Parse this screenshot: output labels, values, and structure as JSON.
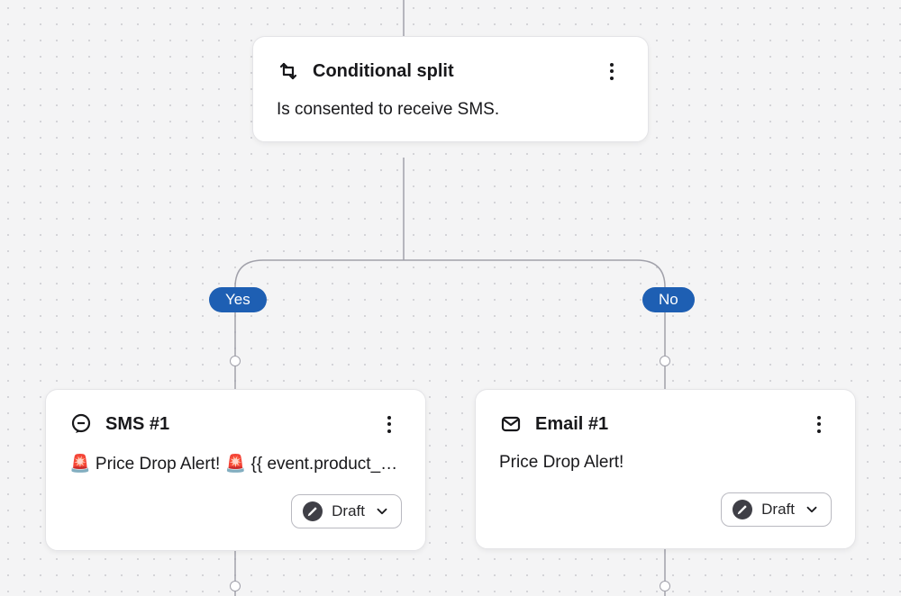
{
  "conditional": {
    "title": "Conditional split",
    "description": "Is consented to receive SMS."
  },
  "branches": {
    "yes_label": "Yes",
    "no_label": "No"
  },
  "sms_node": {
    "title": "SMS #1",
    "preview": "🚨 Price Drop Alert! 🚨 {{ event.product_n…",
    "status_label": "Draft"
  },
  "email_node": {
    "title": "Email #1",
    "preview": "Price Drop Alert!",
    "status_label": "Draft"
  }
}
